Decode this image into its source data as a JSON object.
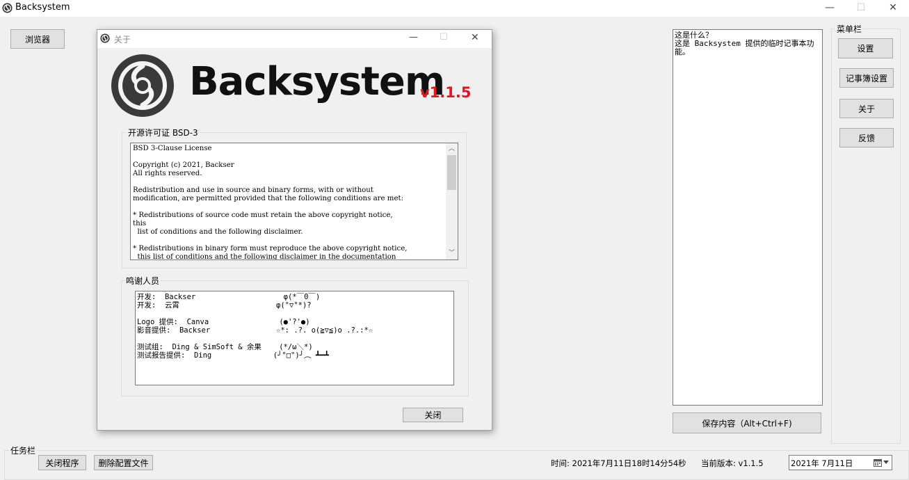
{
  "window": {
    "title": "Backsystem",
    "controls": {
      "minimize": "—",
      "maximize": "☐",
      "close": "✕"
    }
  },
  "browser_button": "浏览器",
  "menu": {
    "title": "菜单栏",
    "items": [
      "设置",
      "记事簿设置",
      "关于",
      "反馈"
    ]
  },
  "note": {
    "content": "这是什么？\n这是 Backsystem 提供的临时记事本功能。",
    "save_label": "保存内容（Alt+Ctrl+F)"
  },
  "taskbar": {
    "title": "任务栏",
    "close_program": "关闭程序",
    "delete_config": "删除配置文件"
  },
  "status": {
    "time": "时间: 2021年7月11日18时14分54秒",
    "version": "当前版本: v1.1.5",
    "date_value": "2021年  7月11日"
  },
  "about": {
    "title": "关于",
    "brand": "Backsystem",
    "version": "v1.1.5",
    "license_group": "开源许可证 BSD-3",
    "license_text": "BSD 3-Clause License\n\nCopyright (c) 2021, Backser\nAll rights reserved.\n\nRedistribution and use in source and binary forms, with or without\nmodification, are permitted provided that the following conditions are met:\n\n* Redistributions of source code must retain the above copyright notice,\nthis\n  list of conditions and the following disclaimer.\n\n* Redistributions in binary form must reproduce the above copyright notice,\n  this list of conditions and the following disclaimer in the documentation",
    "credits_group": "鸣谢人员",
    "credits_text": "开发:  Backser                    φ(*￣0￣)\n开发:  云霄                      φ(°▽°*)?\n\nLogo 提供:  Canva                (●'?'●)\n影音提供:  Backser               ☆*: .?. o(≧▽≦)o .?.:*☆\n\n测试组:  Ding & SimSoft & 余果    (*/ω＼*)\n测试报告提供:  Ding              (╯°□°)╯︵ ┻━┻",
    "close_label": "关闭"
  },
  "colors": {
    "version_red": "#e8141e",
    "focus_blue": "#0078d7"
  },
  "icons": [
    "backsystem-logo-icon",
    "calendar-icon",
    "chevron-down-icon",
    "scroll-up-icon",
    "scroll-down-icon"
  ]
}
